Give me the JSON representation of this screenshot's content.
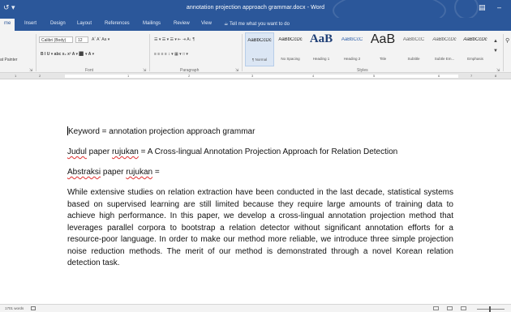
{
  "window": {
    "title": "annotation projection approach grammar.docx - Word",
    "qat_glyph": "↺ ▾"
  },
  "tabs": [
    "me",
    "Insert",
    "Design",
    "Layout",
    "References",
    "Mailings",
    "Review",
    "View"
  ],
  "tell_me": "☕ Tell me what you want to do",
  "ribbon": {
    "clipboard": {
      "painter": "at Painter",
      "label": ""
    },
    "font": {
      "name": "Calibri (Body)",
      "size": "12",
      "label": "Font",
      "row1_extra": "Aˆ Aˇ  Aa ▾",
      "row2": "B  I  U ▾  abc  x₂  x²    A ▾  ⬛ ▾  A ▾"
    },
    "paragraph": {
      "label": "Paragraph",
      "row1": "☰ ▾  ☰ ▾  ☰ ▾   ⇤ ⇥   A↓   ¶",
      "row2": "≡  ≡  ≡  ≡   ↕ ▾   ▦ ▾   □ ▾"
    },
    "styles": {
      "label": "Styles",
      "items": [
        {
          "preview": "AaBbCcDc",
          "name": "¶ Normal"
        },
        {
          "preview": "AaBbCcDc",
          "name": "No Spacing"
        },
        {
          "preview": "AaB",
          "name": "Heading 1"
        },
        {
          "preview": "AaBbCcC",
          "name": "Heading 2"
        },
        {
          "preview": "AaB",
          "name": "Title"
        },
        {
          "preview": "AaBbCcC",
          "name": "Subtitle"
        },
        {
          "preview": "AaBbCcDc",
          "name": "Subtle Em..."
        },
        {
          "preview": "AaBbCcDc",
          "name": "Emphasis"
        }
      ]
    }
  },
  "ruler": {
    "numbers": [
      "1",
      "2",
      "1",
      "2",
      "3",
      "4",
      "5",
      "6",
      "7",
      "8"
    ]
  },
  "document": {
    "line1": "Keyword = annotation projection approach grammar",
    "line2_pre": "Judul",
    "line2_mid": " paper ",
    "line2_sq": "rujukan",
    "line2_post": " = A Cross-lingual Annotation Projection Approach for Relation Detection",
    "line3_pre": "Abstraksi",
    "line3_mid": " paper ",
    "line3_sq": "rujukan",
    "line3_post": " =",
    "body": "While extensive studies on relation extraction have been conducted in the last decade, statistical systems based on supervised learning are still limited because they require large amounts of training data to achieve high performance. In this paper, we develop a cross-lingual annotation projection method that leverages parallel corpora to bootstrap a relation detector without significant annotation efforts for a resource-poor language. In order to make our method more reliable, we introduce three simple projection noise reduction methods. The merit of our method is demonstrated through a novel Korean relation detection task."
  },
  "status": {
    "words": "1701 words"
  },
  "colors": {
    "accent": "#2b579a",
    "squiggle": "#e03030"
  }
}
